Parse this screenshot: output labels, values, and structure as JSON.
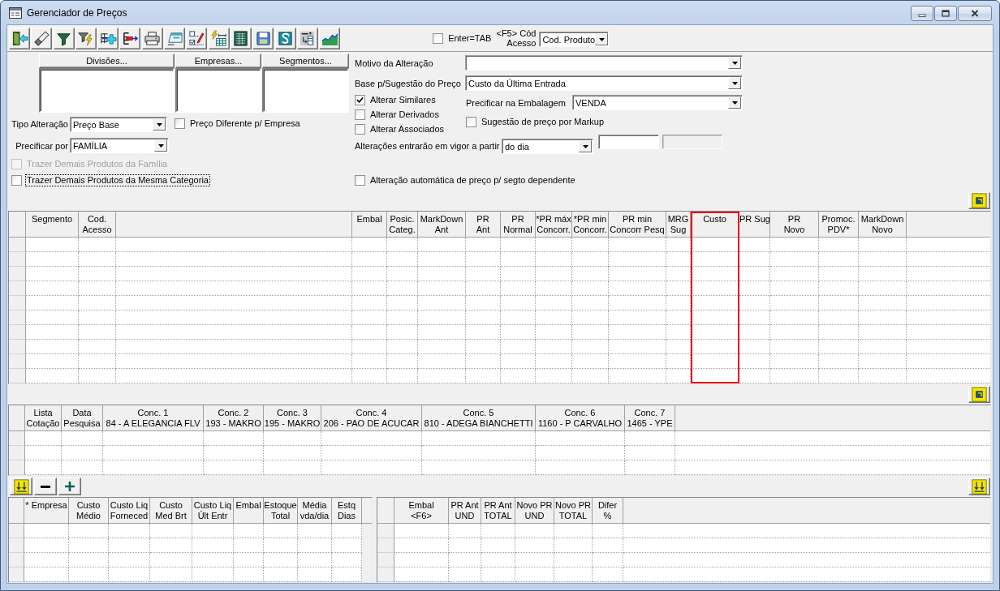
{
  "window": {
    "title": "Gerenciador de Preços"
  },
  "toolbar": {
    "enter_tab": {
      "label": "Enter=TAB",
      "checked": false
    },
    "access_key": {
      "lines": [
        "<F5> Cód",
        "Acesso"
      ],
      "value": "Cod. Produto"
    }
  },
  "form": {
    "list_buttons": [
      {
        "label": "Divisões..."
      },
      {
        "label": "Empresas..."
      },
      {
        "label": "Segmentos..."
      }
    ],
    "tipo_alteracao": {
      "label": "Tipo Alteração",
      "value": "Preço Base"
    },
    "preco_diferente": {
      "label": "Preço Diferente p/ Empresa",
      "checked": false
    },
    "precificar_por": {
      "label": "Precificar por",
      "value": "FAMÍLIA"
    },
    "trazer": [
      {
        "label": "Trazer Demais Produtos da Família",
        "checked": false,
        "disabled": true,
        "focused": false
      },
      {
        "label": "Trazer Demais Produtos da Mesma Categoria",
        "checked": false,
        "disabled": false,
        "focused": true
      }
    ],
    "motivo": {
      "label": "Motivo da Alteração"
    },
    "base_sugestao": {
      "label": "Base p/Sugestão do Preço",
      "value": "Custo da Última Entrada"
    },
    "alterar": [
      {
        "label": "Alterar Similares",
        "checked": true
      },
      {
        "label": "Alterar Derivados",
        "checked": false
      },
      {
        "label": "Alterar Associados",
        "checked": false
      }
    ],
    "precificar_embalagem": {
      "label": "Precificar na Embalagem",
      "value": "VENDA"
    },
    "sugestao_markup": {
      "label": "Sugestão de preço por Markup",
      "checked": false
    },
    "vigor": {
      "label": "Alterações entrarão em vigor a partir",
      "value": "do dia",
      "fields": [
        {
          "disabled": false
        },
        {
          "disabled": true
        }
      ]
    },
    "alteracao_automatica": {
      "label": "Alteração automática de preço p/ segto dependente",
      "checked": false
    }
  },
  "price_grid": {
    "columns": [
      {
        "lines": [
          "Segmento"
        ],
        "highlighted": false
      },
      {
        "lines": [
          "Cod.",
          "Acesso"
        ],
        "highlighted": false
      },
      {
        "highlighted": false
      },
      {
        "lines": [
          "Embal"
        ],
        "highlighted": false
      },
      {
        "lines": [
          "Posic.",
          "Categ."
        ],
        "highlighted": false
      },
      {
        "lines": [
          "MarkDown",
          "Ant"
        ],
        "highlighted": false
      },
      {
        "lines": [
          "PR",
          "Ant"
        ],
        "highlighted": false
      },
      {
        "lines": [
          "PR",
          "Normal"
        ],
        "highlighted": false
      },
      {
        "lines": [
          "*PR máx",
          "Concorr."
        ],
        "highlighted": false
      },
      {
        "lines": [
          "*PR min",
          "Concorr."
        ],
        "highlighted": false
      },
      {
        "lines": [
          "PR min",
          "Concorr Pesq"
        ],
        "highlighted": false
      },
      {
        "lines": [
          "MRG",
          "Sug"
        ],
        "highlighted": false
      },
      {
        "lines": [
          "Custo"
        ],
        "highlighted": true
      },
      {
        "lines": [
          "PR Sug"
        ],
        "highlighted": false
      },
      {
        "lines": [
          "PR",
          "Novo"
        ],
        "highlighted": false
      },
      {
        "lines": [
          "Promoc.",
          "PDV*"
        ],
        "highlighted": false
      },
      {
        "lines": [
          "MarkDown",
          "Novo"
        ],
        "highlighted": false
      }
    ]
  },
  "competitor_grid": {
    "columns": [
      {
        "lines": [
          "Lista",
          "Cotação"
        ]
      },
      {
        "lines": [
          "Data",
          "Pesquisa"
        ]
      },
      {
        "lines": [
          "Conc. 1",
          "84 - A ELEGANCIA FLV"
        ]
      },
      {
        "lines": [
          "Conc. 2",
          "193 - MAKRO"
        ]
      },
      {
        "lines": [
          "Conc. 3",
          "195 - MAKRO"
        ]
      },
      {
        "lines": [
          "Conc. 4",
          "206 - PAO DE ACUCAR"
        ]
      },
      {
        "lines": [
          "Conc. 5",
          "810 - ADEGA BIANCHETTI"
        ]
      },
      {
        "lines": [
          "Conc. 6",
          "1160 - P CARVALHO"
        ]
      },
      {
        "lines": [
          "Conc. 7",
          "1465 - YPE"
        ]
      }
    ]
  },
  "company_grid": {
    "columns": [
      {
        "lines": [
          "* Empresa"
        ]
      },
      {
        "lines": [
          "Custo",
          "Médio"
        ]
      },
      {
        "lines": [
          "Custo Liq",
          "Forneced"
        ]
      },
      {
        "lines": [
          "Custo",
          "Med Brt"
        ]
      },
      {
        "lines": [
          "Custo Liq",
          "Últ Entr"
        ]
      },
      {
        "lines": [
          "Embal"
        ]
      },
      {
        "lines": [
          "Estoque",
          "Total"
        ]
      },
      {
        "lines": [
          "Média",
          "vda/dia"
        ]
      },
      {
        "lines": [
          "Estq",
          "Dias"
        ]
      }
    ]
  },
  "package_grid": {
    "columns": [
      {
        "lines": [
          "Embal",
          "<F6>"
        ]
      },
      {
        "lines": [
          "PR Ant",
          "UND"
        ]
      },
      {
        "lines": [
          "PR Ant",
          "TOTAL"
        ]
      },
      {
        "lines": [
          "Novo PR",
          "UND"
        ]
      },
      {
        "lines": [
          "Novo PR",
          "TOTAL"
        ]
      },
      {
        "lines": [
          "Difer",
          "%"
        ]
      }
    ]
  }
}
